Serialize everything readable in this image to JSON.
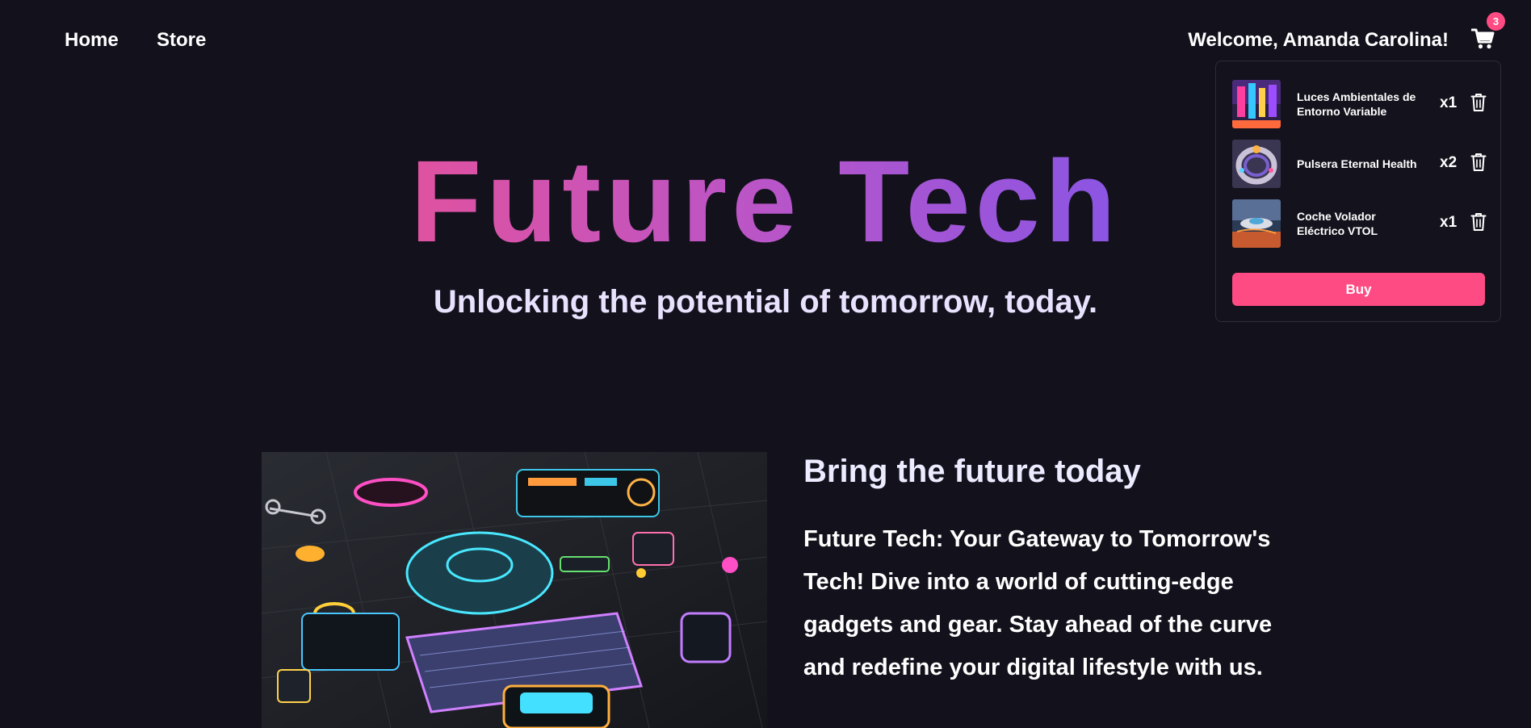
{
  "nav": {
    "home": "Home",
    "store": "Store"
  },
  "header": {
    "welcome": "Welcome, Amanda Carolina!",
    "cart_count": "3"
  },
  "cart": {
    "items": [
      {
        "name": "Luces Ambientales de Entorno Variable",
        "qty": "x1"
      },
      {
        "name": "Pulsera Eternal Health",
        "qty": "x2"
      },
      {
        "name": "Coche Volador Eléctrico VTOL",
        "qty": "x1"
      }
    ],
    "buy_label": "Buy"
  },
  "hero": {
    "title": "Future Tech",
    "subtitle": "Unlocking the potential of tomorrow, today."
  },
  "feature": {
    "heading": "Bring the future today",
    "text": "Future Tech: Your Gateway to Tomorrow's Tech! Dive into a world of cutting-edge gadgets and gear. Stay ahead of the curve and redefine your digital lifestyle with us."
  },
  "colors": {
    "background": "#13121c",
    "accent": "#ff4b83",
    "title_gradient_start": "#e052a0",
    "title_gradient_end": "#8a55e4"
  },
  "icons": {
    "cart": "shopping-cart-icon",
    "trash": "trash-icon"
  }
}
